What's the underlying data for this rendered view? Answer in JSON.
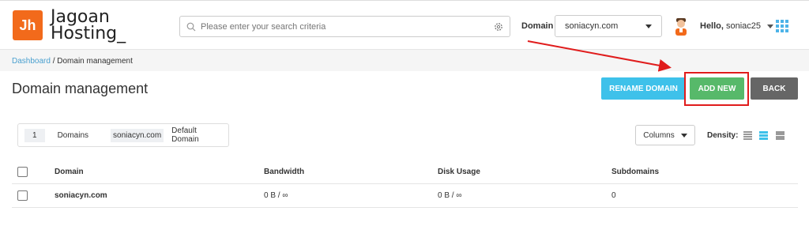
{
  "brand": {
    "logo_glyph": "Jh",
    "line1": "Jagoan",
    "line2": "Hosting_"
  },
  "search": {
    "placeholder": "Please enter your search criteria"
  },
  "domain_selector": {
    "label": "Domain",
    "value": "soniacyn.com"
  },
  "user": {
    "greeting": "Hello,",
    "name": "soniac25"
  },
  "breadcrumb": {
    "home": "Dashboard",
    "separator": "/",
    "current": "Domain management"
  },
  "page": {
    "title": "Domain management"
  },
  "actions": {
    "rename": "RENAME DOMAIN",
    "add_new": "ADD NEW",
    "back": "BACK"
  },
  "summary": {
    "count": "1",
    "count_label": "Domains",
    "domain": "soniacyn.com",
    "default_label": "Default Domain"
  },
  "toolbar": {
    "columns_label": "Columns",
    "density_label": "Density:"
  },
  "table": {
    "headers": {
      "domain": "Domain",
      "bandwidth": "Bandwidth",
      "disk": "Disk Usage",
      "subdomains": "Subdomains"
    },
    "rows": [
      {
        "domain": "soniacyn.com",
        "bandwidth": "0 B / ∞",
        "disk": "0 B / ∞",
        "subdomains": "0"
      }
    ]
  },
  "colors": {
    "accent": "#3ec1ea",
    "add": "#57b96a",
    "back": "#666666",
    "logo": "#f26a1b",
    "annotation": "#e01c1c"
  }
}
